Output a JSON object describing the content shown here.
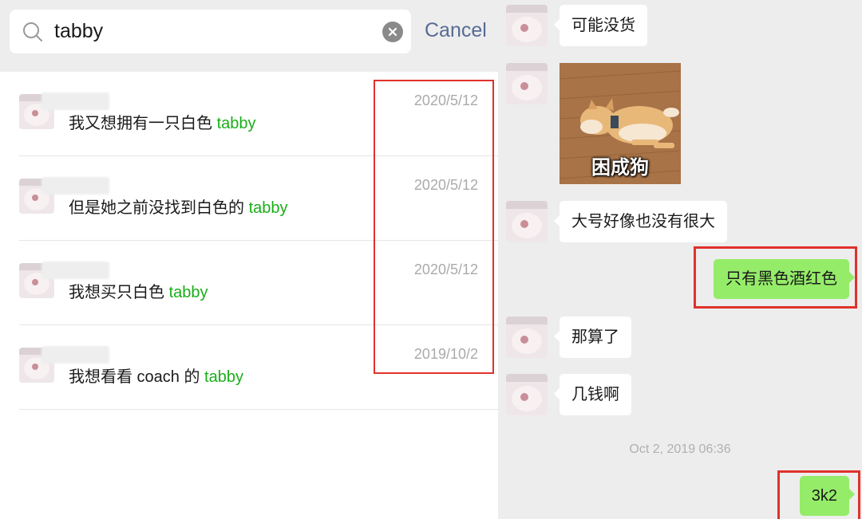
{
  "search": {
    "query": "tabby",
    "cancel_label": "Cancel"
  },
  "results": [
    {
      "message_prefix": "我又想拥有一只白色 ",
      "highlight": "tabby",
      "message_suffix": "",
      "date": "2020/5/12"
    },
    {
      "message_prefix": "但是她之前没找到白色的 ",
      "highlight": "tabby",
      "message_suffix": "",
      "date": "2020/5/12"
    },
    {
      "message_prefix": "我想买只白色 ",
      "highlight": "tabby",
      "message_suffix": "",
      "date": "2020/5/12"
    },
    {
      "message_prefix": "我想看看 coach 的 ",
      "highlight": "tabby",
      "message_suffix": "",
      "date": "2019/10/2"
    }
  ],
  "chat": {
    "messages": [
      {
        "from": "other",
        "text": "可能没货"
      },
      {
        "from": "other",
        "sticker_caption": "困成狗"
      },
      {
        "from": "other",
        "text": "大号好像也没有很大"
      },
      {
        "from": "me",
        "text": "只有黑色酒红色"
      },
      {
        "from": "other",
        "text": "那算了"
      },
      {
        "from": "other",
        "text": "几钱啊"
      },
      {
        "from": "me",
        "text": "3k2"
      }
    ],
    "timestamp": "Oct 2, 2019 06:36"
  },
  "colors": {
    "highlight": "#1aad19",
    "link": "#576b95",
    "bubble_out": "#95ec69",
    "annotation": "#e0322b"
  }
}
